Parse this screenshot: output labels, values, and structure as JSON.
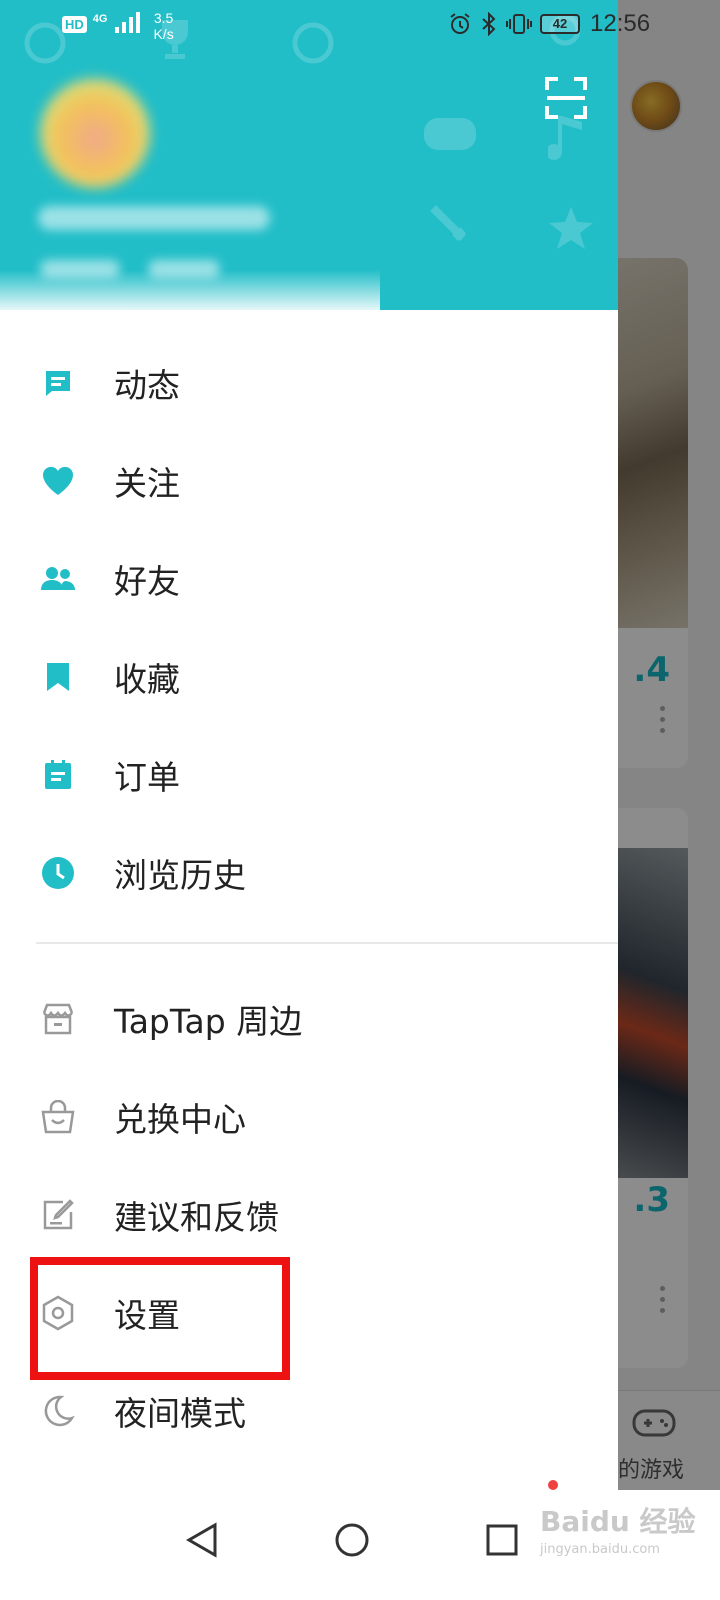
{
  "status_bar": {
    "network_badge": "HD",
    "network_type": "4G",
    "speed_value": "3.5",
    "speed_unit": "K/s",
    "battery": "42",
    "time": "12:56"
  },
  "drawer": {
    "menu_primary": [
      {
        "label": "动态",
        "icon": "message-icon"
      },
      {
        "label": "关注",
        "icon": "heart-icon"
      },
      {
        "label": "好友",
        "icon": "friends-icon"
      },
      {
        "label": "收藏",
        "icon": "bookmark-icon"
      },
      {
        "label": "订单",
        "icon": "order-icon"
      },
      {
        "label": "浏览历史",
        "icon": "clock-icon"
      }
    ],
    "menu_secondary": [
      {
        "label": "TapTap 周边",
        "icon": "store-icon"
      },
      {
        "label": "兑换中心",
        "icon": "bag-icon"
      },
      {
        "label": "建议和反馈",
        "icon": "edit-icon"
      },
      {
        "label": "设置",
        "icon": "gear-icon"
      },
      {
        "label": "夜间模式",
        "icon": "moon-icon"
      }
    ]
  },
  "background": {
    "card_scores": [
      "4",
      "3"
    ],
    "bottom_tab_label": "的游戏"
  },
  "watermark": {
    "main": "Baidu 经验",
    "sub": "jingyan.baidu.com"
  },
  "colors": {
    "accent": "#22bec8",
    "highlight": "#ee1111",
    "text": "#222222"
  }
}
